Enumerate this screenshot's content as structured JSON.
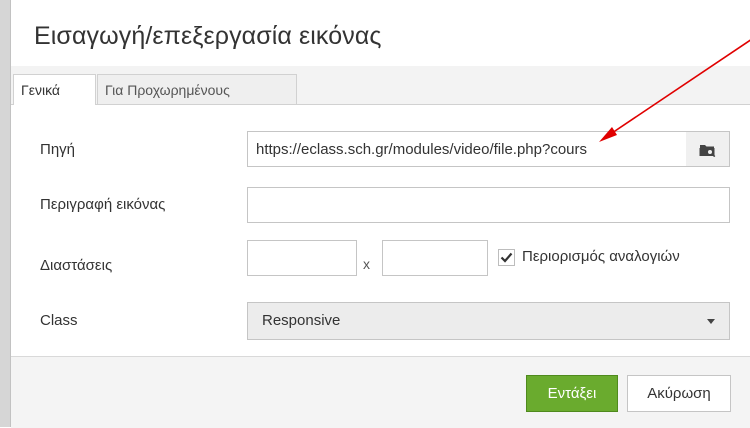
{
  "dialog": {
    "title": "Εισαγωγή/επεξεργασία εικόνας"
  },
  "tabs": [
    {
      "label": "Γενικά",
      "active": true
    },
    {
      "label": "Για Προχωρημένους",
      "active": false
    }
  ],
  "form": {
    "source_label": "Πηγή",
    "source_value": "https://eclass.sch.gr/modules/video/file.php?cours",
    "description_label": "Περιγραφή εικόνας",
    "description_value": "",
    "dimensions_label": "Διαστάσεις",
    "width_value": "",
    "height_value": "",
    "times_symbol": "x",
    "constrain_label": "Περιορισμός αναλογιών",
    "constrain_checked": true,
    "class_label": "Class",
    "class_value": "Responsive"
  },
  "footer": {
    "ok_label": "Εντάξει",
    "cancel_label": "Ακύρωση"
  },
  "colors": {
    "ok_button": "#6aab2e",
    "annotation_arrow": "#e00000"
  },
  "icons": {
    "browse": "folder-search-icon",
    "dropdown": "caret-down-icon",
    "checkbox": "checkmark-icon"
  }
}
